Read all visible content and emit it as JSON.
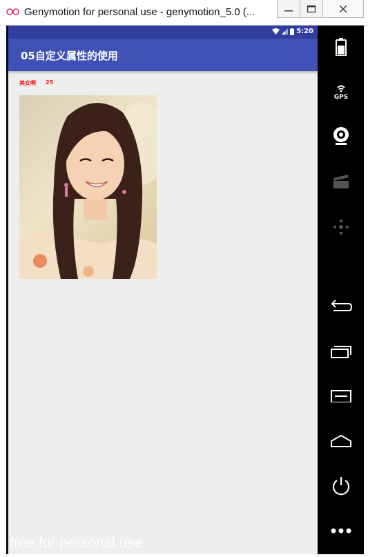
{
  "window": {
    "title": "Genymotion for personal use - genymotion_5.0 (..."
  },
  "statusbar": {
    "time": "5:20"
  },
  "app": {
    "title": "05自定义属性的使用",
    "custom_view": {
      "name": "美女啊",
      "age": "25"
    },
    "watermark": "free for personal use"
  },
  "sidepanel": {
    "items": [
      "battery-icon",
      "gps-icon",
      "webcam-icon",
      "capture-icon",
      "dpad-icon",
      "back-icon",
      "recent-apps-icon",
      "menu-icon",
      "home-icon",
      "power-icon",
      "more-icon"
    ],
    "gps_label": "GPS"
  },
  "colors": {
    "statusbar": "#303f9f",
    "toolbar": "#3f51b5",
    "screen_bg": "#eeeeee",
    "custom_text": "#ff1a1a"
  }
}
